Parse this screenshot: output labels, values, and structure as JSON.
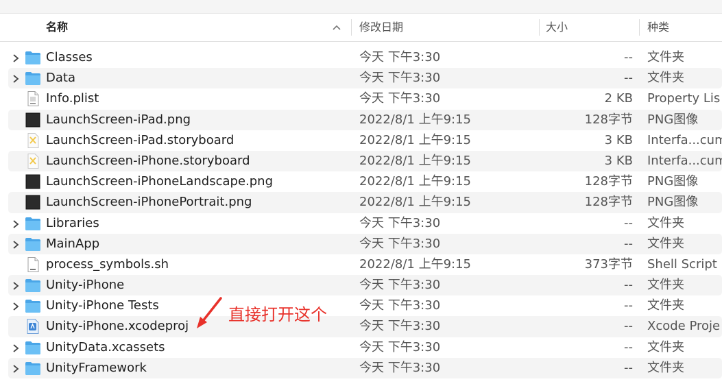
{
  "header": {
    "name": "名称",
    "date": "修改日期",
    "size": "大小",
    "kind": "种类"
  },
  "rows": [
    {
      "name": "Classes",
      "date": "今天 下午3:30",
      "size": "--",
      "kind": "文件夹",
      "icon": "folder-icon",
      "expandable": true
    },
    {
      "name": "Data",
      "date": "今天 下午3:30",
      "size": "--",
      "kind": "文件夹",
      "icon": "folder-icon",
      "expandable": true
    },
    {
      "name": "Info.plist",
      "date": "今天 下午3:30",
      "size": "2 KB",
      "kind": "Property Lis",
      "icon": "plist-file-icon",
      "expandable": false
    },
    {
      "name": "LaunchScreen-iPad.png",
      "date": "2022/8/1 上午9:15",
      "size": "128字节",
      "kind": "PNG图像",
      "icon": "png-thumbnail-icon",
      "expandable": false
    },
    {
      "name": "LaunchScreen-iPad.storyboard",
      "date": "2022/8/1 上午9:15",
      "size": "3 KB",
      "kind": "Interfa...cum",
      "icon": "storyboard-file-icon",
      "expandable": false
    },
    {
      "name": "LaunchScreen-iPhone.storyboard",
      "date": "2022/8/1 上午9:15",
      "size": "3 KB",
      "kind": "Interfa...cum",
      "icon": "storyboard-file-icon",
      "expandable": false
    },
    {
      "name": "LaunchScreen-iPhoneLandscape.png",
      "date": "2022/8/1 上午9:15",
      "size": "128字节",
      "kind": "PNG图像",
      "icon": "png-thumbnail-icon",
      "expandable": false
    },
    {
      "name": "LaunchScreen-iPhonePortrait.png",
      "date": "2022/8/1 上午9:15",
      "size": "128字节",
      "kind": "PNG图像",
      "icon": "png-thumbnail-icon",
      "expandable": false
    },
    {
      "name": "Libraries",
      "date": "今天 下午3:30",
      "size": "--",
      "kind": "文件夹",
      "icon": "folder-icon",
      "expandable": true
    },
    {
      "name": "MainApp",
      "date": "今天 下午3:30",
      "size": "--",
      "kind": "文件夹",
      "icon": "folder-icon",
      "expandable": true
    },
    {
      "name": "process_symbols.sh",
      "date": "2022/8/1 上午9:15",
      "size": "373字节",
      "kind": "Shell Script",
      "icon": "shell-script-icon",
      "expandable": false
    },
    {
      "name": "Unity-iPhone",
      "date": "今天 下午3:30",
      "size": "--",
      "kind": "文件夹",
      "icon": "folder-icon",
      "expandable": true
    },
    {
      "name": "Unity-iPhone Tests",
      "date": "今天 下午3:30",
      "size": "--",
      "kind": "文件夹",
      "icon": "folder-icon",
      "expandable": true
    },
    {
      "name": "Unity-iPhone.xcodeproj",
      "date": "今天 下午3:30",
      "size": "--",
      "kind": "Xcode Proje",
      "icon": "xcodeproj-icon",
      "expandable": false
    },
    {
      "name": "UnityData.xcassets",
      "date": "今天 下午3:30",
      "size": "--",
      "kind": "文件夹",
      "icon": "folder-icon",
      "expandable": true
    },
    {
      "name": "UnityFramework",
      "date": "今天 下午3:30",
      "size": "--",
      "kind": "文件夹",
      "icon": "folder-icon",
      "expandable": true
    }
  ],
  "annotation": {
    "text": "直接打开这个",
    "color": "#e8312a"
  },
  "colors": {
    "folder": "#5ab4ee",
    "stripe": "#f4f4f4",
    "annotation": "#e8312a"
  }
}
